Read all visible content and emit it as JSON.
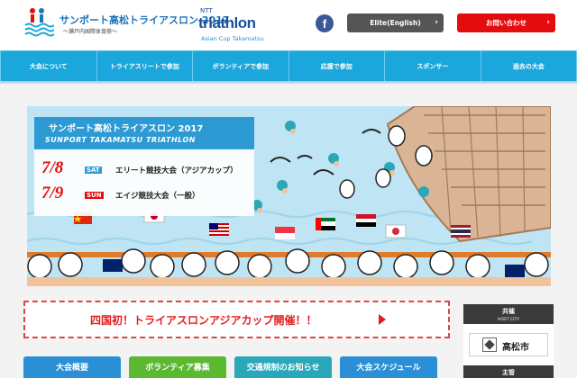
{
  "header": {
    "site_title": "サンポート高松トライアスロン 2017",
    "site_subtitle": "〜瀬戸内国際体育祭〜",
    "ntt_line1": "NTT",
    "ntt_line2": "triathlon",
    "ntt_line3": "Asian Cup  Takamatsu",
    "facebook_icon": "f",
    "elite_label": "Elite(English)",
    "contact_label": "お問い合わせ",
    "chevron": "›"
  },
  "nav": {
    "items": [
      {
        "label": "大会について"
      },
      {
        "label": "トライアスリートで参加"
      },
      {
        "label": "ボランティアで参加"
      },
      {
        "label": "応援で参加"
      },
      {
        "label": "スポンサー"
      },
      {
        "label": "過去の大会"
      }
    ]
  },
  "hero": {
    "title_jp": "サンポート高松トライアスロン 2017",
    "title_en": "SUNPORT TAKAMATSU TRIATHLON",
    "events": [
      {
        "date": "7/8",
        "day": "SAT",
        "day_color": "#2d9ad4",
        "name": "エリート競技大会（アジアカップ）"
      },
      {
        "date": "7/9",
        "day": "SUN",
        "day_color": "#e40c0c",
        "name": "エイジ競技大会（一般）"
      }
    ]
  },
  "banner": {
    "text": "四国初！トライアスロンアジアカップ開催！！"
  },
  "side": {
    "host_jp": "共催",
    "host_en": "HOST CITY",
    "city_name": "高松市",
    "organizer_jp": "主管"
  },
  "tiles": [
    {
      "label": "大会概要",
      "color": "#2b8fd6"
    },
    {
      "label": "ボランティア募集",
      "color": "#5bb931"
    },
    {
      "label": "交通規制のお知らせ",
      "color": "#2aa7b8"
    },
    {
      "label": "大会スケジュール",
      "color": "#2b8fd6"
    }
  ],
  "colors": {
    "accent": "#1ba6dc",
    "brand_blue": "#1e73b8",
    "alert_red": "#e40c0c"
  }
}
